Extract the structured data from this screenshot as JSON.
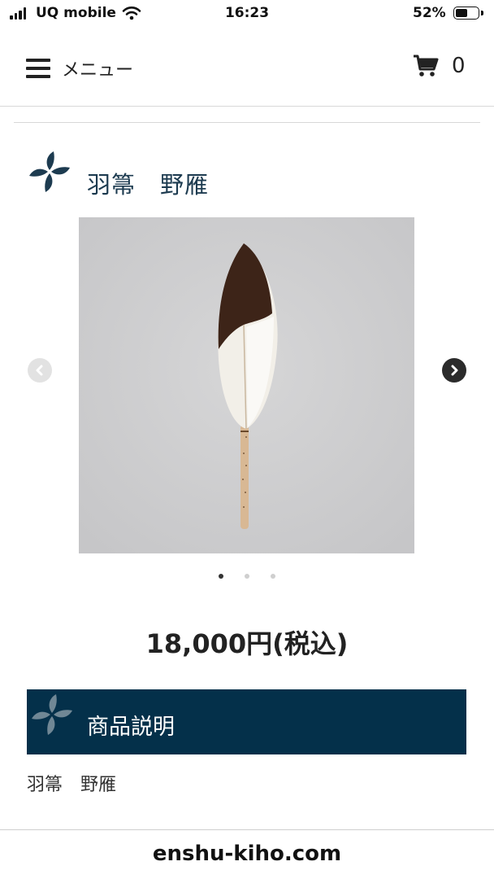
{
  "status_bar": {
    "carrier": "UQ mobile",
    "time": "16:23",
    "battery_percent": "52%",
    "battery_level": 0.52
  },
  "header": {
    "menu_label": "メニュー",
    "menu_icon": "hamburger-icon",
    "cart_icon": "cart-icon",
    "cart_count": "0"
  },
  "product": {
    "logo_icon": "brand-logo-icon",
    "title": "羽箒　野雁",
    "price": "18,000円(税込)",
    "carousel": {
      "prev_icon": "chevron-left-icon",
      "next_icon": "chevron-right-icon",
      "total_slides": 3,
      "active_slide": 1
    }
  },
  "description_section": {
    "title": "商品説明",
    "body": "羽箒　野雁"
  },
  "footer": {
    "url": "enshu-kiho.com"
  },
  "colors": {
    "brand_navy": "#04304a",
    "title_text": "#1d3b50",
    "photo_background": "#cfcfd0"
  }
}
